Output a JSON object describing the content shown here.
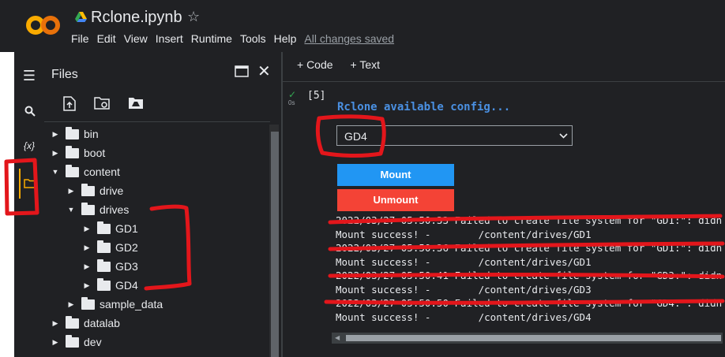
{
  "app": {
    "logo_text": "CO",
    "title": "Rclone.ipynb",
    "menu": [
      "File",
      "Edit",
      "View",
      "Insert",
      "Runtime",
      "Tools",
      "Help"
    ],
    "save_status": "All changes saved"
  },
  "rail": {
    "icons": [
      "menu-icon",
      "search-icon",
      "variables-icon",
      "folder-icon"
    ],
    "variables_text": "{x}"
  },
  "files": {
    "title": "Files",
    "tree": [
      {
        "name": "bin",
        "depth": 0,
        "open": false
      },
      {
        "name": "boot",
        "depth": 0,
        "open": false
      },
      {
        "name": "content",
        "depth": 0,
        "open": true
      },
      {
        "name": "drive",
        "depth": 1,
        "open": false
      },
      {
        "name": "drives",
        "depth": 1,
        "open": true
      },
      {
        "name": "GD1",
        "depth": 2,
        "open": false
      },
      {
        "name": "GD2",
        "depth": 2,
        "open": false
      },
      {
        "name": "GD3",
        "depth": 2,
        "open": false
      },
      {
        "name": "GD4",
        "depth": 2,
        "open": false
      },
      {
        "name": "sample_data",
        "depth": 1,
        "open": false
      },
      {
        "name": "datalab",
        "depth": 0,
        "open": false
      },
      {
        "name": "dev",
        "depth": 0,
        "open": false
      }
    ]
  },
  "toolbar": {
    "code_label": "+ Code",
    "text_label": "+ Text"
  },
  "cell": {
    "exec_count": "[5]",
    "exec_time": "0s",
    "output_title": "Rclone available config...",
    "select_value": "GD4",
    "mount_label": "Mount",
    "unmount_label": "Unmount",
    "log_lines": [
      "2022/03/27 05:50:33 Failed to create file system for \"GD1:\": didn't",
      "Mount success! -        /content/drives/GD1",
      "2022/03/27 05:50:36 Failed to create file system for \"GD1:\": didn't",
      "Mount success! -        /content/drives/GD1",
      "2022/03/27 05:50:41 Failed to create file system for \"GD3:\": didn't",
      "Mount success! -        /content/drives/GD3",
      "2022/03/27 05:50:50 Failed to create file system for \"GD4:\": didn't",
      "Mount success! -        /content/drives/GD4"
    ]
  },
  "colors": {
    "background": "#202124",
    "mount_button": "#2196f3",
    "unmount_button": "#f44336",
    "output_title": "#4a90e2",
    "annotation": "#e3161b"
  }
}
